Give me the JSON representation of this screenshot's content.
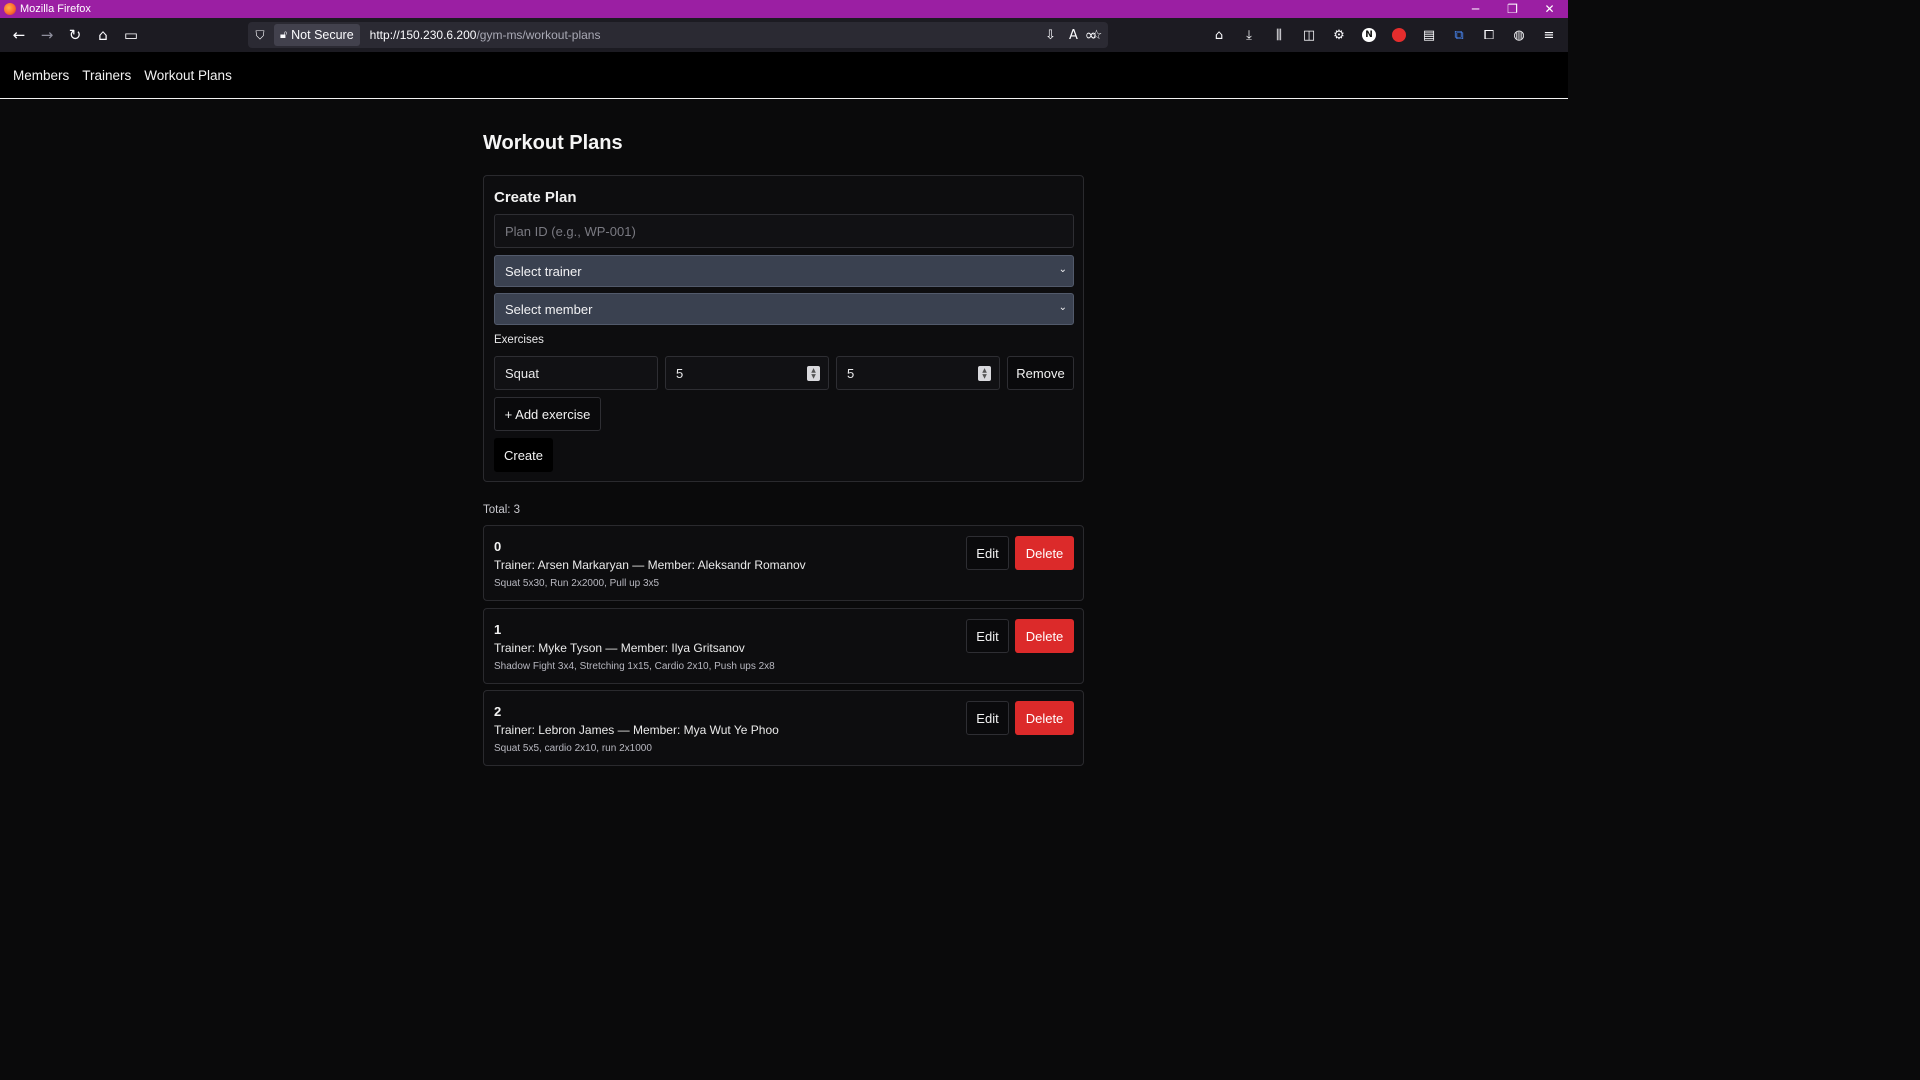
{
  "window": {
    "title": "Mozilla Firefox"
  },
  "browser": {
    "security_label": "Not Secure",
    "url_host": "http://150.230.6.200",
    "url_path": "/gym-ms/workout-plans"
  },
  "nav": {
    "members": "Members",
    "trainers": "Trainers",
    "workout_plans": "Workout Plans"
  },
  "page": {
    "title": "Workout Plans"
  },
  "form": {
    "title": "Create Plan",
    "plan_id_placeholder": "Plan ID (e.g., WP-001)",
    "trainer_select": "Select trainer",
    "member_select": "Select member",
    "exercises_label": "Exercises",
    "exercise": {
      "name": "Squat",
      "sets": "5",
      "reps": "5"
    },
    "remove_label": "Remove",
    "add_exercise_label": "+ Add exercise",
    "create_label": "Create"
  },
  "list": {
    "total_label": "Total: 3",
    "edit_label": "Edit",
    "delete_label": "Delete",
    "plans": [
      {
        "id": "0",
        "who": "Trainer: Arsen Markaryan — Member: Aleksandr Romanov",
        "exercises": "Squat 5x30, Run 2x2000, Pull up 3x5"
      },
      {
        "id": "1",
        "who": "Trainer: Myke Tyson — Member: Ilya Gritsanov",
        "exercises": "Shadow Fight 3x4, Stretching 1x15, Cardio 2x10, Push ups 2x8"
      },
      {
        "id": "2",
        "who": "Trainer: Lebron James — Member: Mya Wut Ye Phoo",
        "exercises": "Squat 5x5, cardio 2x10, run 2x1000"
      }
    ]
  }
}
